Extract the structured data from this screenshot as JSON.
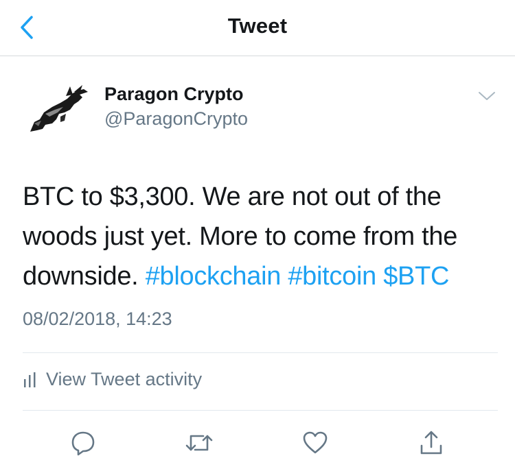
{
  "nav": {
    "title": "Tweet",
    "back_icon": "chevron-left-icon",
    "accent": "#1da1f2"
  },
  "tweet": {
    "display_name": "Paragon Crypto",
    "handle": "@ParagonCrypto",
    "text_lines": [
      "BTC to $3,300. We are not out of the",
      "woods just yet. More to come from the",
      "downside."
    ],
    "links": [
      "#blockchain",
      "#bitcoin",
      "$BTC"
    ],
    "timestamp": "08/02/2018, 14:23",
    "avatar_icon": "bull-logo-icon",
    "menu_icon": "chevron-down-icon"
  },
  "activity": {
    "label": "View Tweet activity",
    "icon": "bar-chart-icon"
  },
  "actions": [
    {
      "name": "reply",
      "icon": "reply-icon"
    },
    {
      "name": "retweet",
      "icon": "retweet-icon"
    },
    {
      "name": "like",
      "icon": "heart-icon"
    },
    {
      "name": "share",
      "icon": "share-icon"
    }
  ],
  "colors": {
    "text": "#14171a",
    "secondary": "#657786",
    "link": "#1da1f2",
    "divider": "#e1e8ed"
  }
}
